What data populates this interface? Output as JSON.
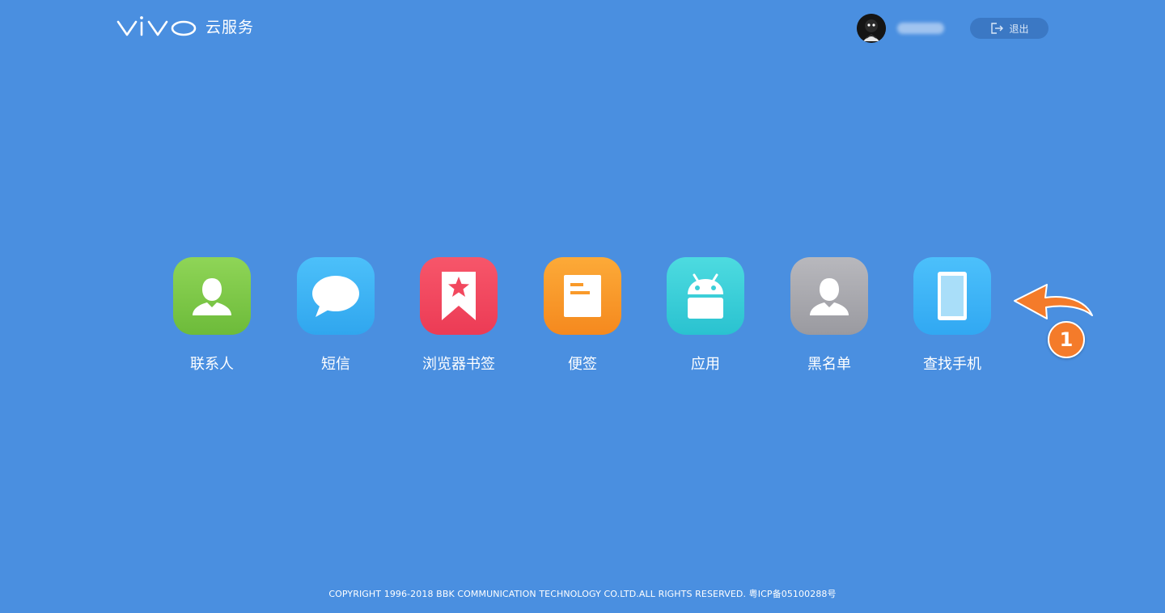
{
  "header": {
    "brand_title": "云服务",
    "logout_label": "退出"
  },
  "apps": [
    {
      "label": "联系人",
      "color": "#7cc842"
    },
    {
      "label": "短信",
      "color": "#3fb3f4"
    },
    {
      "label": "浏览器书签",
      "color": "#f2485e"
    },
    {
      "label": "便签",
      "color": "#f99a2a"
    },
    {
      "label": "应用",
      "color": "#3ccfd8"
    },
    {
      "label": "黑名单",
      "color": "#a9a9ae"
    },
    {
      "label": "查找手机",
      "color": "#3db2f6"
    }
  ],
  "annotation": {
    "badge_number": "1",
    "color": "#f47b2a"
  },
  "footer": {
    "copyright": "COPYRIGHT 1996-2018 BBK COMMUNICATION TECHNOLOGY CO.LTD.ALL RIGHTS RESERVED. 粤ICP备05100288号"
  },
  "colors": {
    "background": "#4a8fe0",
    "logout_button": "#3b78c4"
  }
}
